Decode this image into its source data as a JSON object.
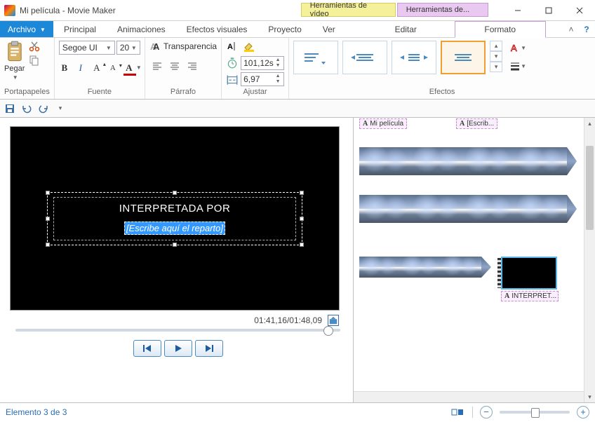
{
  "window": {
    "title": "Mi película - Movie Maker",
    "context_tabs": {
      "video": "Herramientas de vídeo",
      "text": "Herramientas de..."
    }
  },
  "tabs": {
    "file": "Archivo",
    "main": "Principal",
    "anim": "Animaciones",
    "vfx": "Efectos visuales",
    "project": "Proyecto",
    "view": "Ver",
    "edit": "Editar",
    "format": "Formato"
  },
  "ribbon": {
    "clipboard": {
      "label": "Portapapeles",
      "paste": "Pegar"
    },
    "font": {
      "label": "Fuente",
      "family": "Segoe UI",
      "size": "20",
      "transparency": "Transparencia"
    },
    "paragraph": {
      "label": "Párrafo"
    },
    "adjust": {
      "label": "Ajustar",
      "start_time": "101,12s",
      "duration": "6,97"
    },
    "effects": {
      "label": "Efectos"
    }
  },
  "preview": {
    "title_text": "INTERPRETADA POR",
    "placeholder": "[Escribe aquí el reparto]",
    "timecode": "01:41,16/01:48,09"
  },
  "timeline": {
    "label1": "Mi película",
    "label2": "[Escrib...",
    "label3": "INTERPRET..."
  },
  "status": {
    "text": "Elemento 3 de 3"
  },
  "icons": {
    "scissors": "cut-icon",
    "brush": "format-painter-icon",
    "bold": "B",
    "italic": "I",
    "grow": "A",
    "shrink": "A",
    "color": "A",
    "help": "?"
  }
}
